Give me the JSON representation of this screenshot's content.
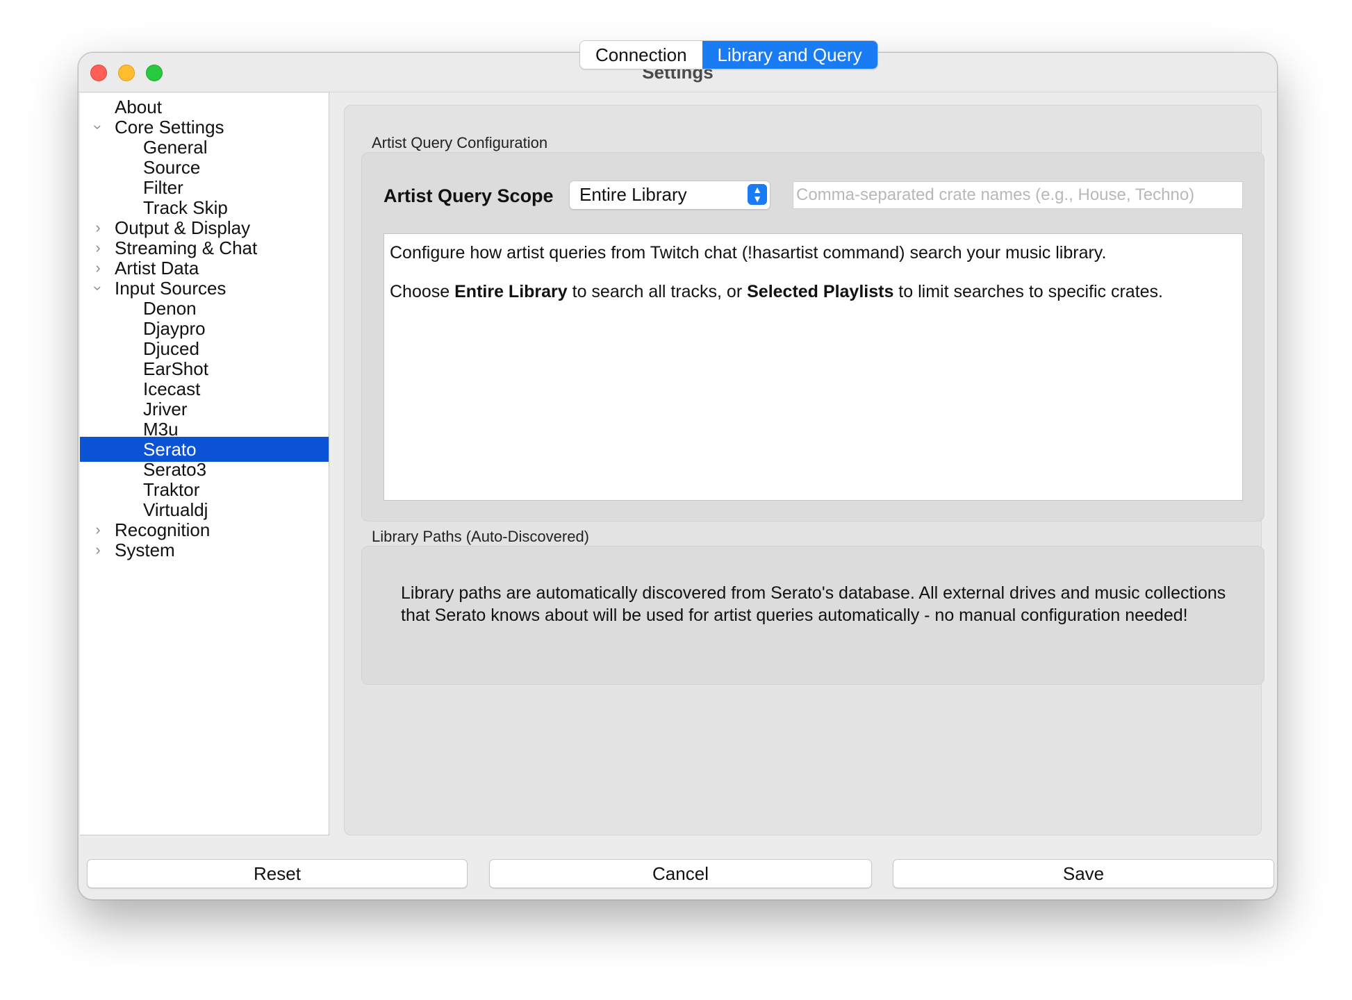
{
  "window": {
    "title": "Settings"
  },
  "sidebar": {
    "items": [
      {
        "label": "About",
        "level": 0,
        "expander": "none"
      },
      {
        "label": "Core Settings",
        "level": 0,
        "expander": "expanded"
      },
      {
        "label": "General",
        "level": 1,
        "expander": "none"
      },
      {
        "label": "Source",
        "level": 1,
        "expander": "none"
      },
      {
        "label": "Filter",
        "level": 1,
        "expander": "none"
      },
      {
        "label": "Track Skip",
        "level": 1,
        "expander": "none"
      },
      {
        "label": "Output & Display",
        "level": 0,
        "expander": "collapsed"
      },
      {
        "label": "Streaming & Chat",
        "level": 0,
        "expander": "collapsed"
      },
      {
        "label": "Artist Data",
        "level": 0,
        "expander": "collapsed"
      },
      {
        "label": "Input Sources",
        "level": 0,
        "expander": "expanded"
      },
      {
        "label": "Denon",
        "level": 1,
        "expander": "none"
      },
      {
        "label": "Djaypro",
        "level": 1,
        "expander": "none"
      },
      {
        "label": "Djuced",
        "level": 1,
        "expander": "none"
      },
      {
        "label": "EarShot",
        "level": 1,
        "expander": "none"
      },
      {
        "label": "Icecast",
        "level": 1,
        "expander": "none"
      },
      {
        "label": "Jriver",
        "level": 1,
        "expander": "none"
      },
      {
        "label": "M3u",
        "level": 1,
        "expander": "none"
      },
      {
        "label": "Serato",
        "level": 1,
        "expander": "none",
        "selected": true
      },
      {
        "label": "Serato3",
        "level": 1,
        "expander": "none"
      },
      {
        "label": "Traktor",
        "level": 1,
        "expander": "none"
      },
      {
        "label": "Virtualdj",
        "level": 1,
        "expander": "none"
      },
      {
        "label": "Recognition",
        "level": 0,
        "expander": "collapsed"
      },
      {
        "label": "System",
        "level": 0,
        "expander": "collapsed"
      }
    ]
  },
  "tabs": [
    {
      "label": "Connection",
      "active": false
    },
    {
      "label": "Library and Query",
      "active": true
    }
  ],
  "artist_query": {
    "section_title": "Artist Query Configuration",
    "scope_label": "Artist Query Scope",
    "scope_value": "Entire Library",
    "crates_placeholder": "Comma-separated crate names (e.g., House, Techno)",
    "info_line1": "Configure how artist queries from Twitch chat (!hasartist command) search your music library.",
    "info_line2_pre": "Choose ",
    "info_line2_bold1": "Entire Library",
    "info_line2_mid": " to search all tracks, or ",
    "info_line2_bold2": "Selected Playlists",
    "info_line2_post": " to limit searches to specific crates."
  },
  "library_paths": {
    "section_title": "Library Paths (Auto-Discovered)",
    "text": "Library paths are automatically discovered from Serato's database. All external drives and music collections that Serato knows about will be used for artist queries automatically - no manual configuration needed!"
  },
  "footer": {
    "reset_label": "Reset",
    "cancel_label": "Cancel",
    "save_label": "Save"
  },
  "colors": {
    "accent": "#1a7cf5",
    "selection": "#0a52d6",
    "close": "#fe5f57",
    "minimize": "#febc2e",
    "zoom": "#28c840"
  }
}
